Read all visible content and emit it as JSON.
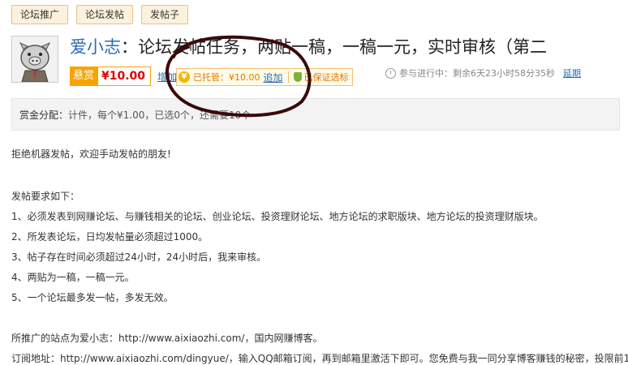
{
  "tags": [
    "论坛推广",
    "论坛发帖",
    "发帖子"
  ],
  "task": {
    "author": "爱小志",
    "title": "：论坛发帖任务，两贴一稿，一稿一元，实时审核（第二"
  },
  "reward": {
    "label": "悬赏",
    "amount": "¥10.00",
    "add_label": "增加"
  },
  "escrow": {
    "label": "已托管：¥10.00",
    "add_label": "追加",
    "guarantee_label": "已保证选标"
  },
  "status": {
    "text": "参与进行中：剩余6天23小时58分35秒",
    "extend_label": "延期"
  },
  "allocation": {
    "label": "赏金分配：",
    "text": "计件，每个¥1.00，已选0个，还需要10个"
  },
  "content": {
    "intro": "拒绝机器发帖，欢迎手动发帖的朋友!",
    "req_title": "发帖要求如下：",
    "requirements": [
      "1、必须发表到网赚论坛、与赚钱相关的论坛、创业论坛、投资理财论坛、地方论坛的求职版块、地方论坛的投资理财版块。",
      "2、所发表论坛，日均发帖量必须超过1000。",
      "3、帖子存在时间必须超过24小时，24小时后，我来审核。",
      "4、两贴为一稿，一稿一元。",
      "5、一个论坛最多发一帖，多发无效。"
    ],
    "site_line": "所推广的站点为爱小志：http://www.aixiaozhi.com/，国内网赚博客。",
    "subscribe_line": "订阅地址：http://www.aixiaozhi.com/dingyue/，输入QQ邮箱订阅，再到邮箱里激活下即可。您免费与我一同分享博客赚钱的秘密，投限前100"
  },
  "colors": {
    "accent_orange": "#f7a400",
    "link_blue": "#2a6bb3",
    "price_red": "#dd0000",
    "tag_bg": "#fbf1dd"
  }
}
